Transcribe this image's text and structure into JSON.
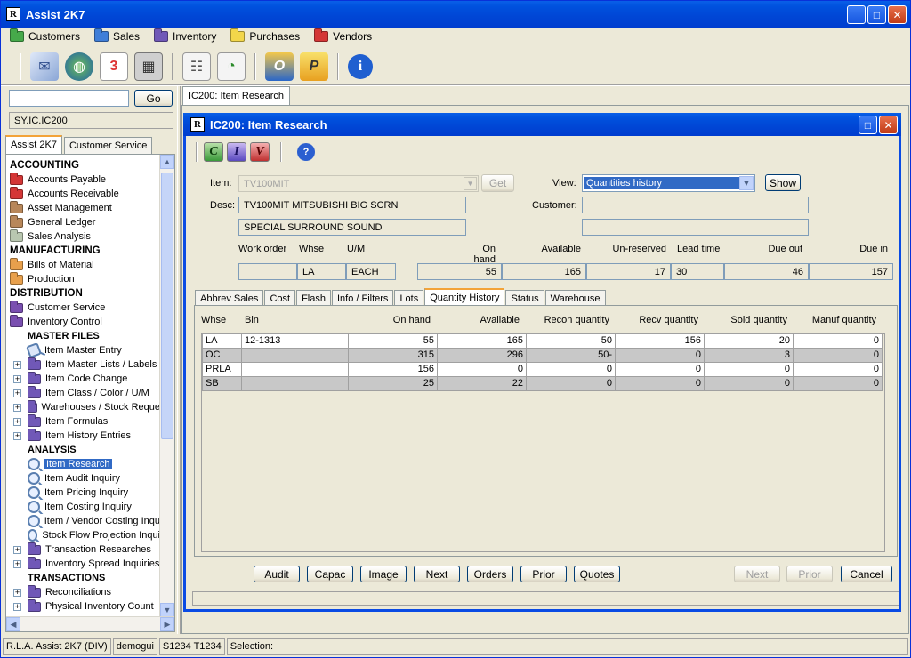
{
  "app": {
    "title": "Assist 2K7"
  },
  "menu": [
    {
      "label": "Customers",
      "color": "#46a94a"
    },
    {
      "label": "Sales",
      "color": "#3f7ed8"
    },
    {
      "label": "Inventory",
      "color": "#7058b7"
    },
    {
      "label": "Purchases",
      "color": "#f2d64a"
    },
    {
      "label": "Vendors",
      "color": "#d43636"
    }
  ],
  "toolbar": {
    "icons": [
      "mail-icon",
      "globe-icon",
      "calendar-icon",
      "calculator-icon",
      "address-book-icon",
      "chart-icon",
      "outlook-icon",
      "p-icon",
      "info-icon"
    ],
    "calendar_text": "3",
    "outlook_text": "O",
    "p_text": "P",
    "info_text": "i"
  },
  "left": {
    "search_value": "",
    "go_label": "Go",
    "code": "SY.IC.IC200",
    "tabs": [
      "Assist 2K7",
      "Customer Service"
    ],
    "tree": [
      {
        "type": "head",
        "label": "ACCOUNTING"
      },
      {
        "type": "folder",
        "label": "Accounts Payable",
        "color": "#d43636"
      },
      {
        "type": "folder",
        "label": "Accounts Receivable",
        "color": "#d43636"
      },
      {
        "type": "folder",
        "label": "Asset Management",
        "color": "#b8875a"
      },
      {
        "type": "folder",
        "label": "General Ledger",
        "color": "#b8875a"
      },
      {
        "type": "folder",
        "label": "Sales Analysis",
        "color": "#b9c7b0"
      },
      {
        "type": "head",
        "label": "MANUFACTURING"
      },
      {
        "type": "folder",
        "label": "Bills of Material",
        "color": "#e8a04c"
      },
      {
        "type": "folder",
        "label": "Production",
        "color": "#e8a04c"
      },
      {
        "type": "head",
        "label": "DISTRIBUTION"
      },
      {
        "type": "folder",
        "label": "Customer Service",
        "color": "#7a4fb0"
      },
      {
        "type": "folder",
        "label": "Inventory Control",
        "color": "#7a4fb0"
      },
      {
        "type": "sub",
        "label": "MASTER FILES"
      },
      {
        "type": "doc",
        "label": "Item Master Entry"
      },
      {
        "type": "l2",
        "label": "Item Master Lists / Labels"
      },
      {
        "type": "l2",
        "label": "Item Code Change"
      },
      {
        "type": "l2",
        "label": "Item Class / Color / U/M"
      },
      {
        "type": "l2",
        "label": "Warehouses / Stock Reque"
      },
      {
        "type": "l2",
        "label": "Item Formulas"
      },
      {
        "type": "l2",
        "label": "Item History Entries"
      },
      {
        "type": "sub",
        "label": "ANALYSIS"
      },
      {
        "type": "mag",
        "label": "Item Research",
        "selected": true
      },
      {
        "type": "mag",
        "label": "Item Audit Inquiry"
      },
      {
        "type": "mag",
        "label": "Item Pricing Inquiry"
      },
      {
        "type": "mag",
        "label": "Item Costing Inquiry"
      },
      {
        "type": "mag",
        "label": "Item / Vendor Costing Inqu"
      },
      {
        "type": "mag",
        "label": "Stock Flow Projection Inqui"
      },
      {
        "type": "l2",
        "label": "Transaction Researches"
      },
      {
        "type": "l2",
        "label": "Inventory Spread Inquiries"
      },
      {
        "type": "sub",
        "label": "TRANSACTIONS"
      },
      {
        "type": "l2",
        "label": "Reconciliations"
      },
      {
        "type": "l2",
        "label": "Physical Inventory Count"
      }
    ]
  },
  "main_tab": "IC200: Item Research",
  "dialog": {
    "title": "IC200: Item Research",
    "letters": [
      "C",
      "I",
      "V"
    ],
    "help_label": "?",
    "item_label": "Item:",
    "item_value": "TV100MIT",
    "get_label": "Get",
    "view_label": "View:",
    "view_value": "Quantities history",
    "show_label": "Show",
    "desc_label": "Desc:",
    "desc1": "TV100MIT MITSUBISHI BIG SCRN",
    "desc2": "SPECIAL SURROUND SOUND",
    "customer_label": "Customer:",
    "customer_value": "",
    "customer_value2": "",
    "info_headers": [
      "Work order",
      "Whse",
      "U/M",
      "On hand",
      "Available",
      "Un-reserved",
      "Lead time",
      "Due out",
      "Due in"
    ],
    "info_values": [
      "",
      "LA",
      "EACH",
      "55",
      "165",
      "17",
      "30",
      "46",
      "157"
    ],
    "tabs": [
      "Abbrev Sales",
      "Cost",
      "Flash",
      "Info / Filters",
      "Lots",
      "Quantity History",
      "Status",
      "Warehouse"
    ],
    "grid_headers": [
      "Whse",
      "Bin",
      "On hand",
      "Available",
      "Recon quantity",
      "Recv quantity",
      "Sold quantity",
      "Manuf quantity"
    ],
    "grid_rows": [
      [
        "LA",
        "12-1313",
        "55",
        "165",
        "50",
        "156",
        "20",
        "0"
      ],
      [
        "OC",
        "",
        "315",
        "296",
        "50-",
        "0",
        "3",
        "0"
      ],
      [
        "PRLA",
        "",
        "156",
        "0",
        "0",
        "0",
        "0",
        "0"
      ],
      [
        "SB",
        "",
        "25",
        "22",
        "0",
        "0",
        "0",
        "0"
      ]
    ],
    "buttons": [
      "Audit",
      "Capac",
      "Image",
      "Next",
      "Orders",
      "Prior",
      "Quotes"
    ],
    "nav_buttons": [
      "Next",
      "Prior"
    ],
    "cancel_label": "Cancel"
  },
  "status": [
    "R.L.A. Assist 2K7 (DIV)",
    "demogui",
    "S1234 T1234",
    "Selection:"
  ]
}
